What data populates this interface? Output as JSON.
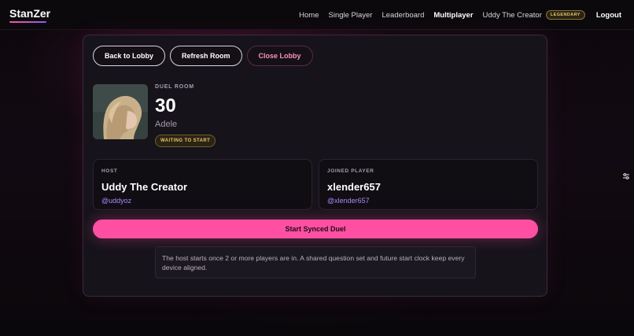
{
  "nav": {
    "brand": "StanZer",
    "links": [
      "Home",
      "Single Player",
      "Leaderboard",
      "Multiplayer"
    ],
    "active": "Multiplayer",
    "user_name": "Uddy The Creator",
    "user_badge": "LEGENDARY",
    "logout": "Logout"
  },
  "room": {
    "buttons": {
      "back": "Back to Lobby",
      "refresh": "Refresh Room",
      "close": "Close Lobby"
    },
    "eyebrow": "DUEL ROOM",
    "title": "30",
    "artist": "Adele",
    "status": "WAITING TO START",
    "host": {
      "label": "HOST",
      "name": "Uddy The Creator",
      "handle": "@uddyoz"
    },
    "joined": {
      "label": "JOINED PLAYER",
      "name": "xlender657",
      "handle": "@xlender657"
    },
    "start_label": "Start Synced Duel",
    "info": "The host starts once 2 or more players are in. A shared question set and future start clock keep every device aligned."
  },
  "colors": {
    "accent": "#ff4fa3",
    "handle": "#a78bfa",
    "badge": "#e8c76a"
  },
  "icons": {
    "side": "settings-sliders-icon"
  }
}
